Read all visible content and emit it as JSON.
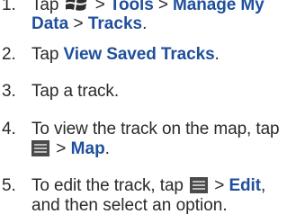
{
  "steps": [
    {
      "number": "1.",
      "tap": "Tap",
      "start_icon": "windows-start-icon",
      "sep1": ">",
      "tools": "Tools",
      "sep2": ">",
      "manage_my": "Manage My",
      "data_word": "Data",
      "sep3": ">",
      "tracks": "Tracks",
      "end": "."
    },
    {
      "number": "2.",
      "tap": "Tap",
      "view_saved_tracks": "View Saved Tracks",
      "end": "."
    },
    {
      "number": "3.",
      "text": "Tap a track."
    },
    {
      "number": "4.",
      "text": "To view the track on the map, tap",
      "menu_icon": "menu-icon",
      "sep": ">",
      "map": "Map",
      "end": "."
    },
    {
      "number": "5.",
      "text": "To edit the track, tap",
      "menu_icon": "menu-icon",
      "sep": ">",
      "edit": "Edit",
      "trail": ",",
      "text2": "and then select an option."
    }
  ],
  "colors": {
    "keyword": "#1f4f9c",
    "body_text": "#2a2a2a",
    "menu_icon": "#4a4a4a"
  }
}
